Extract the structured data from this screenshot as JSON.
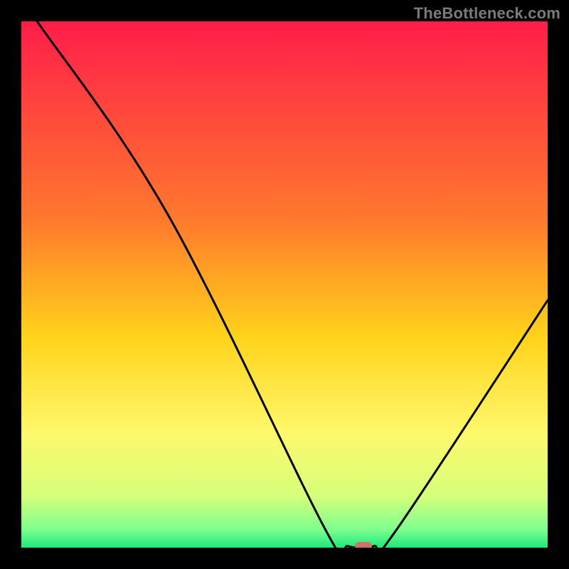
{
  "attribution": "TheBottleneck.com",
  "chart_data": {
    "type": "line",
    "title": "",
    "xlabel": "",
    "ylabel": "",
    "xlim": [
      0,
      100
    ],
    "ylim": [
      0,
      100
    ],
    "gradient_stops": [
      {
        "offset": 0,
        "color": "#ff1d49"
      },
      {
        "offset": 38,
        "color": "#ff7a2d"
      },
      {
        "offset": 60,
        "color": "#ffd31a"
      },
      {
        "offset": 78,
        "color": "#fff86b"
      },
      {
        "offset": 90,
        "color": "#d7ff7a"
      },
      {
        "offset": 96.5,
        "color": "#7fff8f"
      },
      {
        "offset": 100,
        "color": "#1ee87a"
      }
    ],
    "series": [
      {
        "name": "bottleneck-curve",
        "points": [
          {
            "x": 3,
            "y": 100
          },
          {
            "x": 28,
            "y": 63
          },
          {
            "x": 58,
            "y": 3
          },
          {
            "x": 62,
            "y": 0.3
          },
          {
            "x": 67,
            "y": 0.3
          },
          {
            "x": 71,
            "y": 3
          },
          {
            "x": 100,
            "y": 47
          }
        ]
      }
    ],
    "marker": {
      "x": 65,
      "y": 0.3,
      "color": "#d26e6c"
    }
  }
}
